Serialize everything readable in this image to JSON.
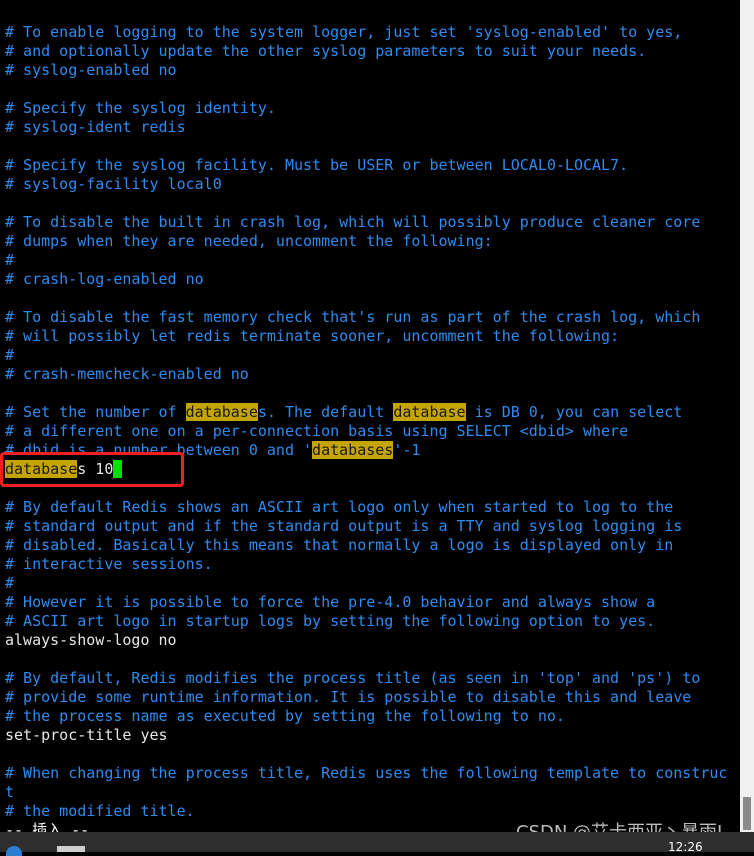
{
  "editor": {
    "lines": [
      [
        {
          "t": "# To enable logging to the system logger, just set 'syslog-enabled' to yes,",
          "c": "comment"
        }
      ],
      [
        {
          "t": "# and optionally update the other syslog parameters to suit your needs.",
          "c": "comment"
        }
      ],
      [
        {
          "t": "# syslog-enabled no",
          "c": "comment"
        }
      ],
      [],
      [
        {
          "t": "# Specify the syslog identity.",
          "c": "comment"
        }
      ],
      [
        {
          "t": "# syslog-ident redis",
          "c": "comment"
        }
      ],
      [],
      [
        {
          "t": "# Specify the syslog facility. Must be USER or between LOCAL0-LOCAL7.",
          "c": "comment"
        }
      ],
      [
        {
          "t": "# syslog-facility local0",
          "c": "comment"
        }
      ],
      [],
      [
        {
          "t": "# To disable the built in crash log, which will possibly produce cleaner core",
          "c": "comment"
        }
      ],
      [
        {
          "t": "# dumps when they are needed, uncomment the following:",
          "c": "comment"
        }
      ],
      [
        {
          "t": "#",
          "c": "comment"
        }
      ],
      [
        {
          "t": "# crash-log-enabled no",
          "c": "comment"
        }
      ],
      [],
      [
        {
          "t": "# To disable the fast memory check that's run as part of the crash log, which",
          "c": "comment"
        }
      ],
      [
        {
          "t": "# will possibly let redis terminate sooner, uncomment the following:",
          "c": "comment"
        }
      ],
      [
        {
          "t": "#",
          "c": "comment"
        }
      ],
      [
        {
          "t": "# crash-memcheck-enabled no",
          "c": "comment"
        }
      ],
      [],
      [
        {
          "t": "# Set the number of ",
          "c": "comment"
        },
        {
          "t": "database",
          "c": "hl"
        },
        {
          "t": "s. The default ",
          "c": "comment"
        },
        {
          "t": "database",
          "c": "hl"
        },
        {
          "t": " is DB 0, you can select",
          "c": "comment"
        }
      ],
      [
        {
          "t": "# a different one on a per-connection basis using SELECT <dbid> where",
          "c": "comment"
        }
      ],
      [
        {
          "t": "# dbid is a number between 0 and '",
          "c": "comment"
        },
        {
          "t": "databases",
          "c": "hl"
        },
        {
          "t": "'-1",
          "c": "comment"
        }
      ],
      [
        {
          "t": "database",
          "c": "hl"
        },
        {
          "t": "s 10",
          "c": "plain"
        },
        {
          "t": " ",
          "c": "cursor"
        }
      ],
      [],
      [
        {
          "t": "# By default Redis shows an ASCII art logo only when started to log to the",
          "c": "comment"
        }
      ],
      [
        {
          "t": "# standard output and if the standard output is a TTY and syslog logging is",
          "c": "comment"
        }
      ],
      [
        {
          "t": "# disabled. Basically this means that normally a logo is displayed only in",
          "c": "comment"
        }
      ],
      [
        {
          "t": "# interactive sessions.",
          "c": "comment"
        }
      ],
      [
        {
          "t": "#",
          "c": "comment"
        }
      ],
      [
        {
          "t": "# However it is possible to force the pre-4.0 behavior and always show a",
          "c": "comment"
        }
      ],
      [
        {
          "t": "# ASCII art logo in startup logs by setting the following option to yes.",
          "c": "comment"
        }
      ],
      [
        {
          "t": "always-show-logo no",
          "c": "plain"
        }
      ],
      [],
      [
        {
          "t": "# By default, Redis modifies the process title (as seen in 'top' and 'ps') to",
          "c": "comment"
        }
      ],
      [
        {
          "t": "# provide some runtime information. It is possible to disable this and leave",
          "c": "comment"
        }
      ],
      [
        {
          "t": "# the process name as executed by setting the following to no.",
          "c": "comment"
        }
      ],
      [
        {
          "t": "set-proc-title yes",
          "c": "plain"
        }
      ],
      [],
      [
        {
          "t": "# When changing the process title, Redis uses the following template to construc",
          "c": "comment"
        }
      ],
      [
        {
          "t": "t",
          "c": "comment"
        }
      ],
      [
        {
          "t": "# the modified title.",
          "c": "comment"
        }
      ],
      [
        {
          "t": "-- 插入 --",
          "c": "status"
        }
      ]
    ]
  },
  "colors": {
    "comment": "#2f8bf0",
    "highlight": "#c4a400",
    "cursor": "#00e000",
    "annotation_box": "#f02020"
  },
  "watermark": "CSDN @艾卡西亚丶暴雨L",
  "taskbar": {
    "clock": "12:26"
  }
}
